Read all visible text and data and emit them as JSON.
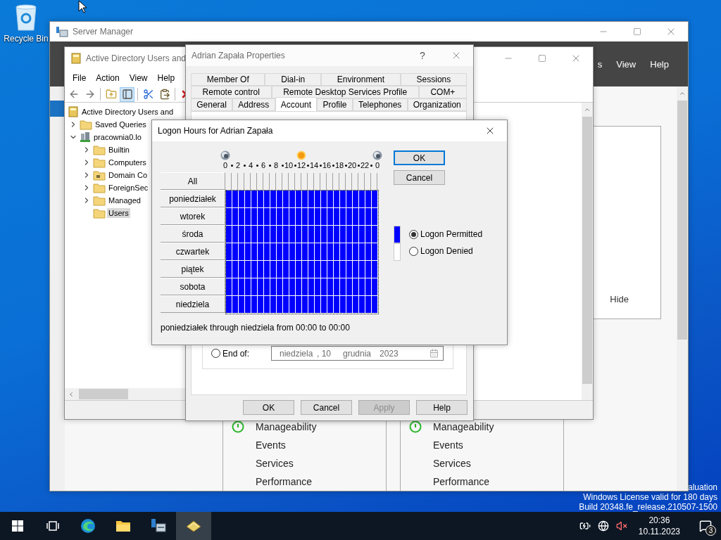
{
  "desktop": {
    "icons": [
      {
        "label": "Recycle Bin"
      }
    ],
    "watermark": [
      "aluation",
      "Windows License valid for 180 days",
      "Build 20348.fe_release.210507-1500"
    ]
  },
  "server_manager": {
    "title": "Server Manager",
    "menu": [
      "s",
      "View",
      "Help"
    ],
    "nav": [
      {
        "selected": true
      }
    ],
    "hide_label": "Hide",
    "tiles": [
      {
        "items": [
          {
            "label": "Manageability",
            "kind": "status"
          },
          {
            "label": "Events",
            "kind": "plain"
          },
          {
            "label": "Services",
            "kind": "plain"
          },
          {
            "label": "Performance",
            "kind": "plain"
          }
        ]
      },
      {
        "items": [
          {
            "label": "Manageability",
            "kind": "status"
          },
          {
            "label": "Events",
            "kind": "plain"
          },
          {
            "label": "Services",
            "kind": "plain"
          },
          {
            "label": "Performance",
            "kind": "plain"
          }
        ]
      }
    ]
  },
  "aduc": {
    "title": "Active Directory Users and",
    "menu": [
      "File",
      "Action",
      "View",
      "Help"
    ],
    "toolbar": [
      {
        "kind": "back",
        "selected": false
      },
      {
        "kind": "forward",
        "selected": false
      },
      {
        "kind": "up",
        "selected": false
      },
      {
        "kind": "view",
        "selected": true
      },
      {
        "kind": "cut",
        "selected": false
      },
      {
        "kind": "paste",
        "selected": false
      },
      {
        "kind": "delete",
        "selected": false
      }
    ],
    "tree": [
      {
        "label": "Active Directory Users and",
        "kind": "root",
        "selected": false,
        "children": [
          {
            "label": "Saved Queries",
            "kind": "folder",
            "expanded": false,
            "selected": false
          },
          {
            "label": "pracownia0.lo",
            "kind": "domain",
            "expanded": true,
            "selected": false,
            "children": [
              {
                "label": "Builtin",
                "kind": "folder",
                "expanded": false,
                "selected": false
              },
              {
                "label": "Computers",
                "kind": "folder",
                "expanded": false,
                "selected": false
              },
              {
                "label": "Domain Co",
                "kind": "ou",
                "expanded": false,
                "selected": false
              },
              {
                "label": "ForeignSec",
                "kind": "folder",
                "expanded": false,
                "selected": false
              },
              {
                "label": "Managed",
                "kind": "folder",
                "expanded": false,
                "selected": false
              },
              {
                "label": "Users",
                "kind": "folder",
                "selected": true
              }
            ]
          }
        ]
      }
    ]
  },
  "properties": {
    "title": "Adrian Zapała Properties",
    "help_glyph": "?",
    "tab_rows": [
      [
        {
          "label": "Member Of",
          "selected": false
        },
        {
          "label": "Dial-in",
          "selected": false
        },
        {
          "label": "Environment",
          "selected": false
        },
        {
          "label": "Sessions",
          "selected": false
        }
      ],
      [
        {
          "label": "Remote control",
          "selected": false
        },
        {
          "label": "Remote Desktop Services Profile",
          "selected": false
        },
        {
          "label": "COM+",
          "selected": false
        }
      ],
      [
        {
          "label": "General",
          "selected": false
        },
        {
          "label": "Address",
          "selected": false
        },
        {
          "label": "Account",
          "selected": true
        },
        {
          "label": "Profile",
          "selected": false
        },
        {
          "label": "Telephones",
          "selected": false
        },
        {
          "label": "Organization",
          "selected": false
        }
      ]
    ],
    "end_of": {
      "label": "End of:",
      "selected": false,
      "date": [
        "niedziela",
        ", 10",
        "grudnia",
        "2023"
      ]
    },
    "buttons": [
      {
        "label": "OK",
        "disabled": false
      },
      {
        "label": "Cancel",
        "disabled": false
      },
      {
        "label": "Apply",
        "disabled": true
      },
      {
        "label": "Help",
        "disabled": false
      }
    ]
  },
  "logon_hours": {
    "title": "Logon Hours for Adrian Zapała",
    "hour_labels": [
      "0",
      "2",
      "4",
      "6",
      "8",
      "10",
      "12",
      "14",
      "16",
      "18",
      "20",
      "22",
      "0"
    ],
    "all_label": "All",
    "days": [
      {
        "label": "poniedziałek",
        "hours": [
          true,
          true,
          true,
          true,
          true,
          true,
          true,
          true,
          true,
          true,
          true,
          true,
          true,
          true,
          true,
          true,
          true,
          true,
          true,
          true,
          true,
          true,
          true,
          true
        ]
      },
      {
        "label": "wtorek",
        "hours": [
          true,
          true,
          true,
          true,
          true,
          true,
          true,
          true,
          true,
          true,
          true,
          true,
          true,
          true,
          true,
          true,
          true,
          true,
          true,
          true,
          true,
          true,
          true,
          true
        ]
      },
      {
        "label": "środa",
        "hours": [
          true,
          true,
          true,
          true,
          true,
          true,
          true,
          true,
          true,
          true,
          true,
          true,
          true,
          true,
          true,
          true,
          true,
          true,
          true,
          true,
          true,
          true,
          true,
          true
        ]
      },
      {
        "label": "czwartek",
        "hours": [
          true,
          true,
          true,
          true,
          true,
          true,
          true,
          true,
          true,
          true,
          true,
          true,
          true,
          true,
          true,
          true,
          true,
          true,
          true,
          true,
          true,
          true,
          true,
          true
        ]
      },
      {
        "label": "piątek",
        "hours": [
          true,
          true,
          true,
          true,
          true,
          true,
          true,
          true,
          true,
          true,
          true,
          true,
          true,
          true,
          true,
          true,
          true,
          true,
          true,
          true,
          true,
          true,
          true,
          true
        ]
      },
      {
        "label": "sobota",
        "hours": [
          true,
          true,
          true,
          true,
          true,
          true,
          true,
          true,
          true,
          true,
          true,
          true,
          true,
          true,
          true,
          true,
          true,
          true,
          true,
          true,
          true,
          true,
          true,
          true
        ]
      },
      {
        "label": "niedziela",
        "hours": [
          true,
          true,
          true,
          true,
          true,
          true,
          true,
          true,
          true,
          true,
          true,
          true,
          true,
          true,
          true,
          true,
          true,
          true,
          true,
          true,
          true,
          true,
          true,
          true
        ]
      }
    ],
    "buttons": [
      {
        "label": "OK",
        "default": true
      },
      {
        "label": "Cancel",
        "default": false
      }
    ],
    "legend": [
      {
        "label": "Logon Permitted",
        "kind": "permitted",
        "selected": true
      },
      {
        "label": "Logon Denied",
        "kind": "denied",
        "selected": false
      }
    ],
    "summary": "poniedziałek through niedziela from 00:00 to 00:00"
  },
  "taskbar": {
    "apps": [
      {
        "kind": "start",
        "selected": false
      },
      {
        "kind": "taskview",
        "selected": false
      },
      {
        "kind": "browser",
        "selected": false
      },
      {
        "kind": "explorer",
        "selected": false
      },
      {
        "kind": "servermanager",
        "selected": false
      },
      {
        "kind": "directory",
        "selected": true
      }
    ],
    "time": "20:36",
    "date": "10.11.2023",
    "notifications": "3"
  }
}
